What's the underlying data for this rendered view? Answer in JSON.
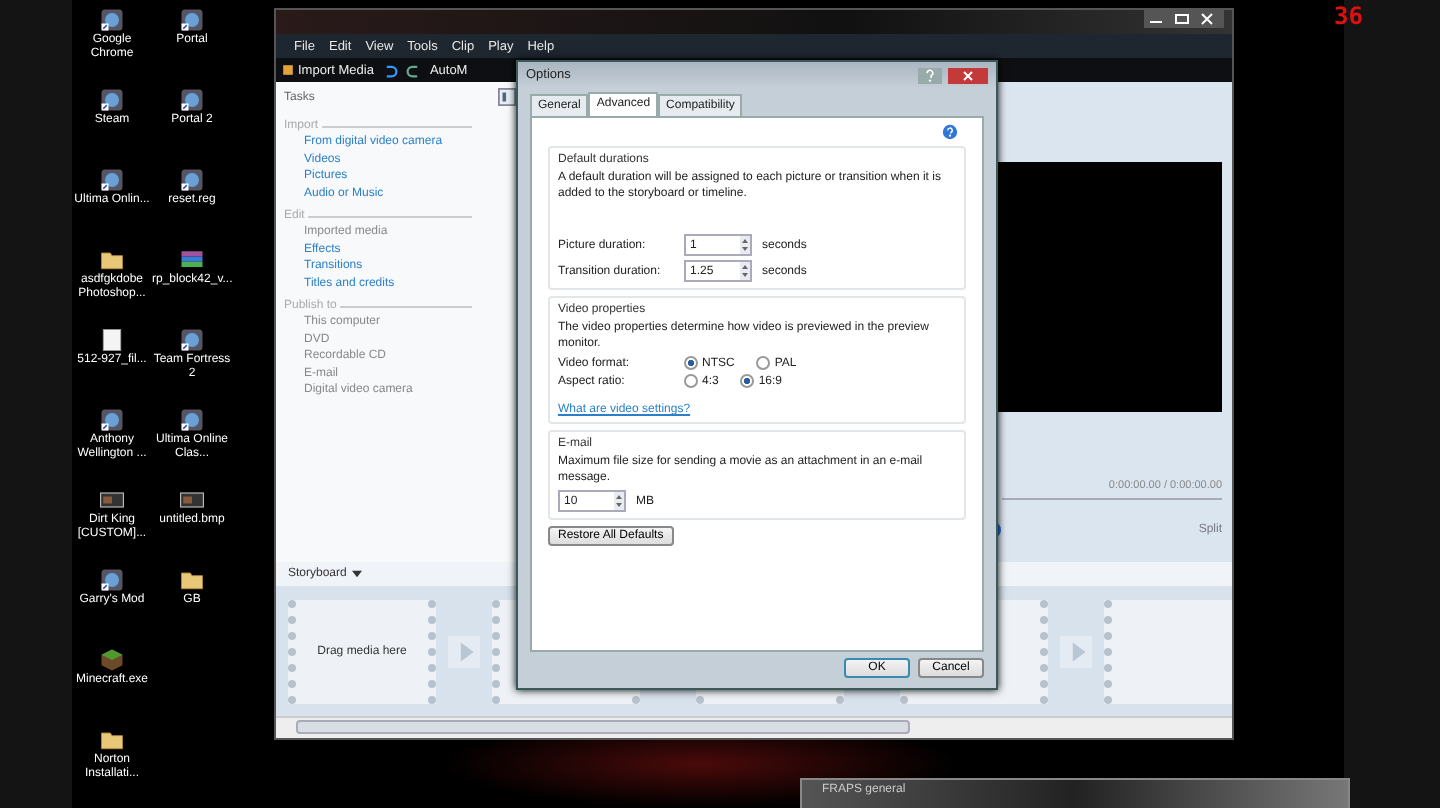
{
  "desktop_icons": [
    {
      "label": "Google Chrome",
      "kind": "app"
    },
    {
      "label": "Steam",
      "kind": "app"
    },
    {
      "label": "Ultima Onlin...",
      "kind": "app"
    },
    {
      "label": "asdfgkdobe Photoshop...",
      "kind": "folder"
    },
    {
      "label": "512-927_fil...",
      "kind": "file"
    },
    {
      "label": "Anthony Wellington ...",
      "kind": "app"
    },
    {
      "label": "Dirt King [CUSTOM]...",
      "kind": "image"
    },
    {
      "label": "Garry's Mod",
      "kind": "app"
    },
    {
      "label": "Minecraft.exe",
      "kind": "block"
    },
    {
      "label": "Norton Installati...",
      "kind": "folder"
    },
    {
      "label": "Portal",
      "kind": "app"
    },
    {
      "label": "Portal 2",
      "kind": "app"
    },
    {
      "label": "reset.reg",
      "kind": "app"
    },
    {
      "label": "rp_block42_v...",
      "kind": "archive"
    },
    {
      "label": "Team Fortress 2",
      "kind": "app"
    },
    {
      "label": "Ultima Online Clas...",
      "kind": "app"
    },
    {
      "label": "untitled.bmp",
      "kind": "image"
    },
    {
      "label": "GB",
      "kind": "folder"
    }
  ],
  "fps_counter": "36",
  "app_window": {
    "menu": [
      "File",
      "Edit",
      "View",
      "Tools",
      "Clip",
      "Play",
      "Help"
    ],
    "toolbar": {
      "import_button": "Import Media",
      "automovie_button": "AutoM"
    },
    "tasks": {
      "title": "Tasks",
      "sections": [
        {
          "heading": "Import",
          "items": [
            {
              "label": "From digital video camera",
              "disabled": false
            },
            {
              "label": "Videos",
              "disabled": false
            },
            {
              "label": "Pictures",
              "disabled": false
            },
            {
              "label": "Audio or Music",
              "disabled": false
            }
          ]
        },
        {
          "heading": "Edit",
          "items": [
            {
              "label": "Imported media",
              "disabled": true
            },
            {
              "label": "Effects",
              "disabled": false
            },
            {
              "label": "Transitions",
              "disabled": false
            },
            {
              "label": "Titles and credits",
              "disabled": false
            }
          ]
        },
        {
          "heading": "Publish to",
          "items": [
            {
              "label": "This computer",
              "disabled": true
            },
            {
              "label": "DVD",
              "disabled": true
            },
            {
              "label": "Recordable CD",
              "disabled": true
            },
            {
              "label": "E-mail",
              "disabled": true
            },
            {
              "label": "Digital video camera",
              "disabled": true
            }
          ]
        }
      ]
    },
    "preview": {
      "time": "0:00:00.00 / 0:00:00.00",
      "split_button": "Split"
    },
    "storyboard": {
      "label": "Storyboard",
      "placeholder": "Drag media here"
    }
  },
  "dialog": {
    "title": "Options",
    "tabs": [
      {
        "label": "General",
        "selected": false
      },
      {
        "label": "Advanced",
        "selected": true
      },
      {
        "label": "Compatibility",
        "selected": false
      }
    ],
    "default_durations": {
      "heading": "Default durations",
      "description": "A default duration will be assigned to each picture or transition when it is added to the storyboard or timeline.",
      "fields": [
        {
          "label": "Picture duration:",
          "value": "1",
          "unit": "seconds"
        },
        {
          "label": "Transition duration:",
          "value": "1.25",
          "unit": "seconds"
        }
      ]
    },
    "video_properties": {
      "heading": "Video properties",
      "description": "The video properties determine how video is previewed in the preview monitor.",
      "rows": [
        {
          "label": "Video format:",
          "options": [
            {
              "label": "NTSC",
              "selected": true
            },
            {
              "label": "PAL",
              "selected": false
            }
          ]
        },
        {
          "label": "Aspect ratio:",
          "options": [
            {
              "label": "4:3",
              "selected": false
            },
            {
              "label": "16:9",
              "selected": true
            }
          ]
        }
      ],
      "link": "What are video settings?"
    },
    "email": {
      "heading": "E-mail",
      "description": "Maximum file size for sending a movie as an attachment in an e-mail message.",
      "value": "10",
      "unit": "MB"
    },
    "restore_button": "Restore All Defaults",
    "buttons": [
      "OK",
      "Cancel"
    ]
  },
  "fraps_window": {
    "title": "FRAPS general"
  }
}
